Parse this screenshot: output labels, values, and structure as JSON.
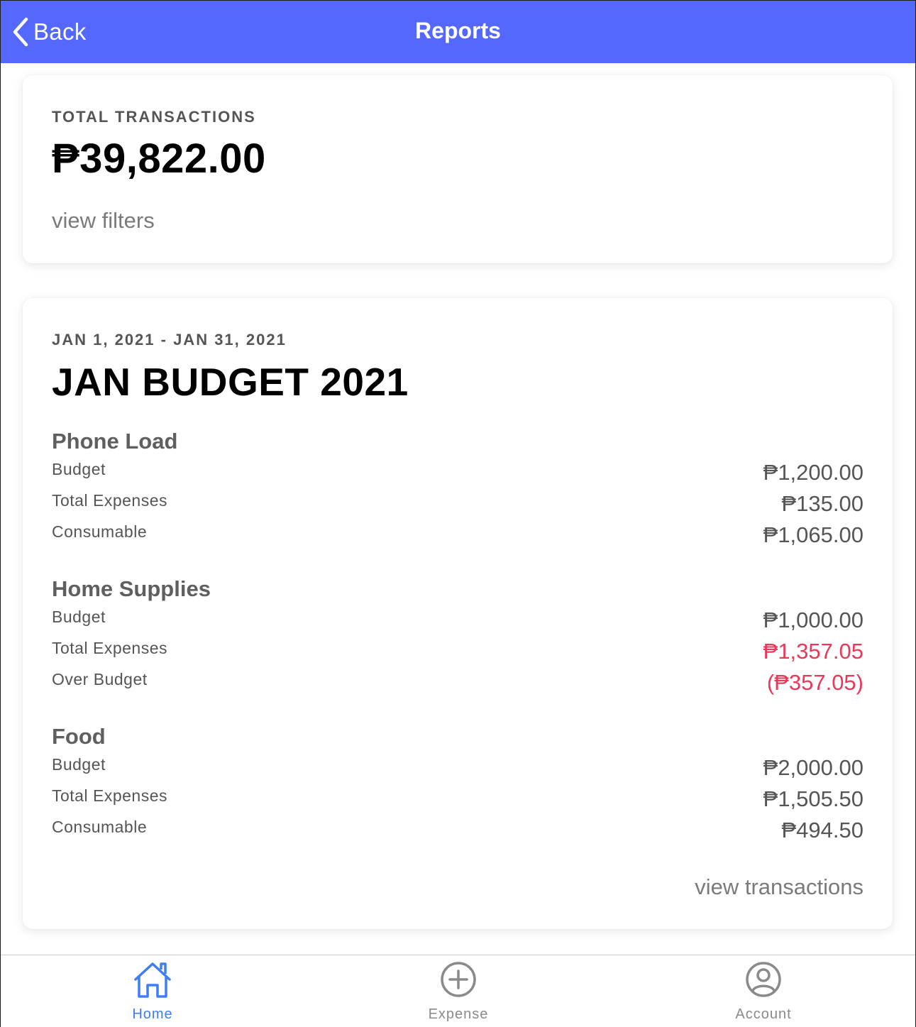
{
  "header": {
    "back_label": "Back",
    "title": "Reports"
  },
  "total_card": {
    "label": "TOTAL TRANSACTIONS",
    "amount": "₱39,822.00",
    "filters_link": "view filters"
  },
  "budget_card": {
    "date_range": "JAN 1, 2021 - JAN 31, 2021",
    "title": "JAN BUDGET 2021",
    "categories": [
      {
        "name": "Phone Load",
        "rows": [
          {
            "label": "Budget",
            "value": "₱1,200.00"
          },
          {
            "label": "Total Expenses",
            "value": "₱135.00"
          },
          {
            "label": "Consumable",
            "value": "₱1,065.00"
          }
        ]
      },
      {
        "name": "Home Supplies",
        "rows": [
          {
            "label": "Budget",
            "value": "₱1,000.00"
          },
          {
            "label": "Total Expenses",
            "value": "₱1,357.05"
          },
          {
            "label": "Over Budget",
            "value": "(₱357.05)"
          }
        ]
      },
      {
        "name": "Food",
        "rows": [
          {
            "label": "Budget",
            "value": "₱2,000.00"
          },
          {
            "label": "Total Expenses",
            "value": "₱1,505.50"
          },
          {
            "label": "Consumable",
            "value": "₱494.50"
          }
        ]
      }
    ],
    "transactions_link": "view transactions"
  },
  "tabbar": {
    "tabs": [
      {
        "label": "Home",
        "icon": "home-icon",
        "active": true
      },
      {
        "label": "Expense",
        "icon": "plus-circle-icon",
        "active": false
      },
      {
        "label": "Account",
        "icon": "user-circle-icon",
        "active": false
      }
    ]
  },
  "colors": {
    "header_bg": "#5568fe",
    "active_tab": "#3f7df2",
    "over_budget": "#e8395a"
  }
}
